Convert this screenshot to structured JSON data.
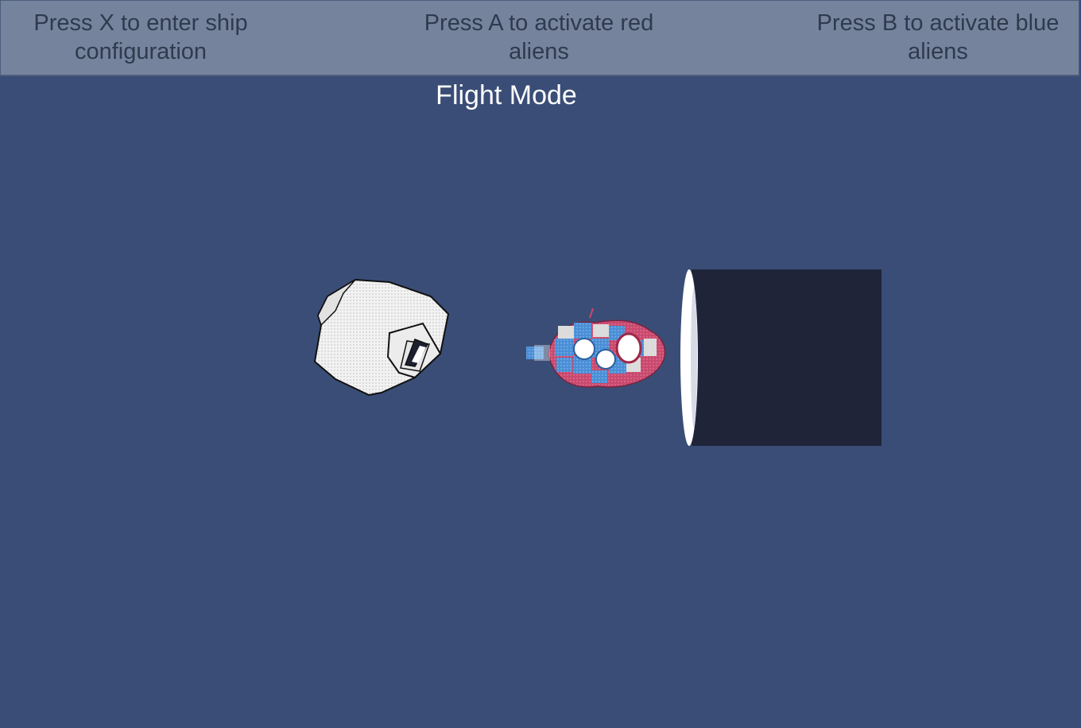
{
  "hud": {
    "hint_ship_config": "Press X to enter ship configuration",
    "hint_red_aliens": "Press A to activate red aliens",
    "hint_blue_aliens": "Press B to activate blue aliens"
  },
  "mode": {
    "label": "Flight Mode"
  },
  "colors": {
    "background": "#3a4d76",
    "hud_bar": "#76839d",
    "hud_text": "#2f3a4d",
    "mode_text": "#ffffff",
    "portal_dark": "#1f2438",
    "ship_red": "#c94a6e",
    "ship_blue": "#4a8fd6"
  },
  "sprites": {
    "asteroid": "asteroid-icon",
    "ship": "alien-ship-icon",
    "portal": "portal-icon"
  }
}
